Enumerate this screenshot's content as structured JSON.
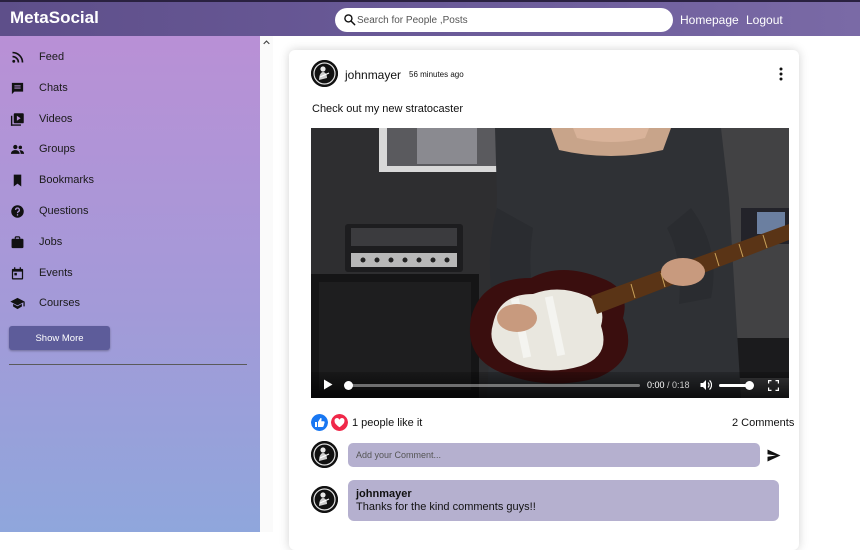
{
  "app": {
    "title": "MetaSocial"
  },
  "search": {
    "placeholder": "Search for People ,Posts"
  },
  "header": {
    "links": [
      "Homepage",
      "Logout"
    ]
  },
  "sidebar": {
    "items": [
      {
        "label": "Feed",
        "icon": "rss-icon"
      },
      {
        "label": "Chats",
        "icon": "chat-icon"
      },
      {
        "label": "Videos",
        "icon": "video-library-icon"
      },
      {
        "label": "Groups",
        "icon": "group-icon"
      },
      {
        "label": "Bookmarks",
        "icon": "bookmark-icon"
      },
      {
        "label": "Questions",
        "icon": "help-icon"
      },
      {
        "label": "Jobs",
        "icon": "briefcase-icon"
      },
      {
        "label": "Events",
        "icon": "calendar-icon"
      },
      {
        "label": "Courses",
        "icon": "school-icon"
      }
    ],
    "show_more_label": "Show More"
  },
  "post": {
    "username": "johnmayer",
    "time_ago": "56 minutes ago",
    "text": "Check out my new stratocaster",
    "video": {
      "current_time": "0:00",
      "duration": "0:18"
    },
    "likes_text": "1 people like it",
    "comments_count": "2 Comments",
    "comment_placeholder": "Add your Comment...",
    "comments": [
      {
        "user": "johnmayer",
        "text": "Thanks for the kind comments guys!!"
      }
    ]
  },
  "colors": {
    "header": "#5e4f8a",
    "sidebar_top": "#b990d6",
    "sidebar_bottom": "#8fa6dc",
    "show_more_button": "#5d5c9a",
    "comment_bg": "#b5b0cf",
    "like_blue": "#1877f2",
    "heart_red": "#f02849"
  }
}
